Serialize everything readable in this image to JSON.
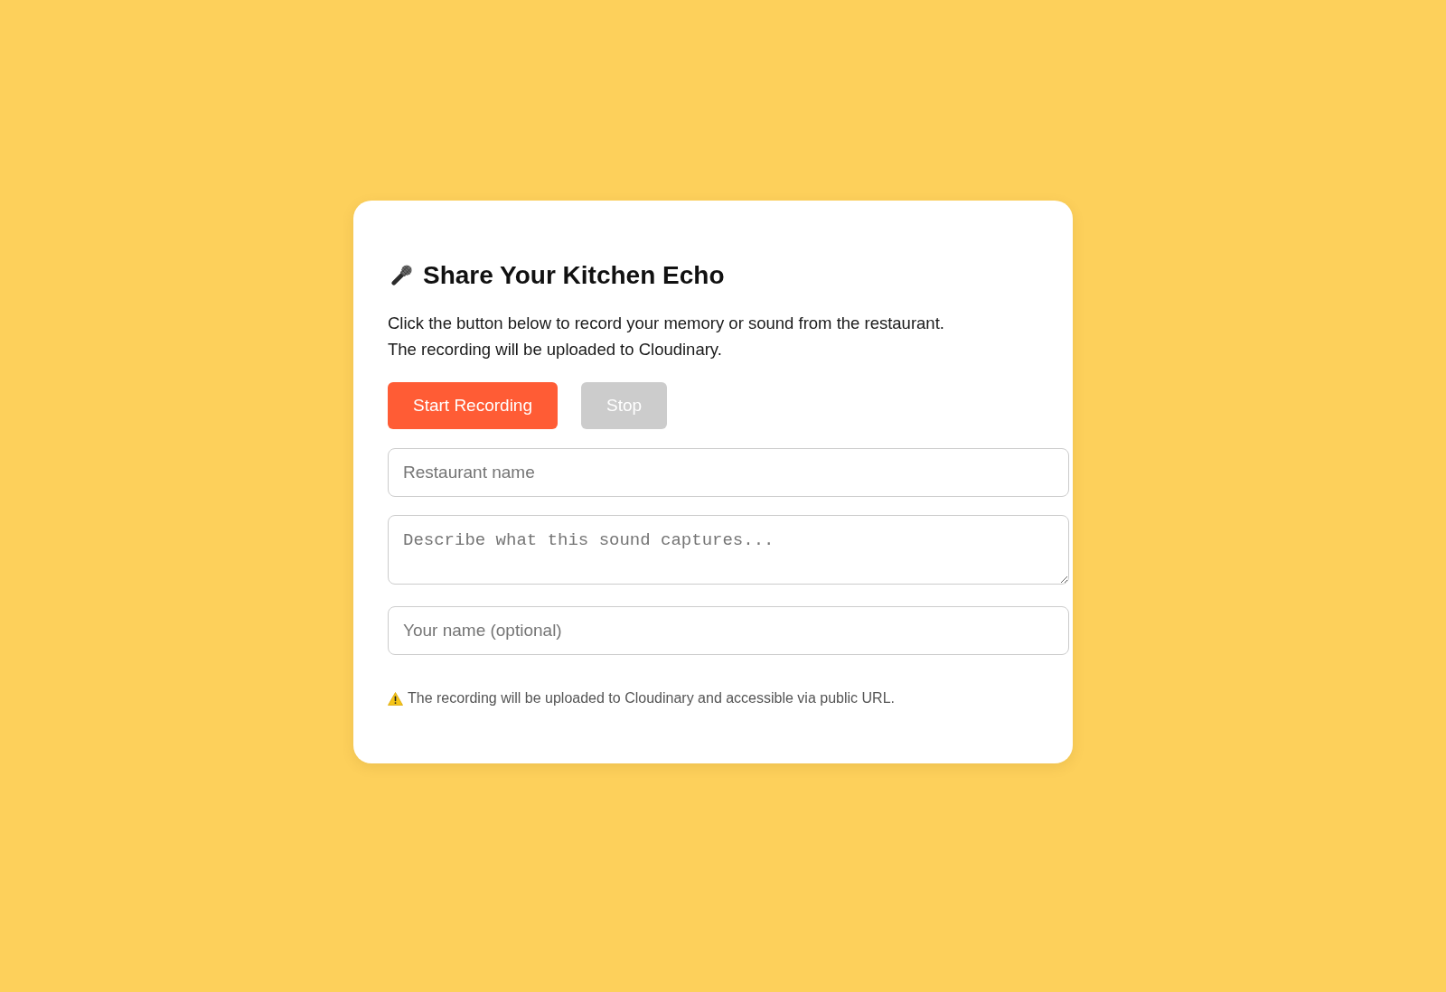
{
  "card": {
    "title": "Share Your Kitchen Echo",
    "description": [
      "Click the button below to record your memory or sound from the restaurant.",
      "The recording will be uploaded to Cloudinary."
    ],
    "buttons": [
      {
        "label": "Start Recording",
        "kind": "primary",
        "disabled": false
      },
      {
        "label": "Stop",
        "kind": "secondary",
        "disabled": true
      }
    ],
    "fields": [
      {
        "kind": "input",
        "placeholder": "Restaurant name"
      },
      {
        "kind": "textarea",
        "placeholder": "Describe what this sound captures..."
      },
      {
        "kind": "input",
        "placeholder": "Your name (optional)"
      }
    ],
    "notice": "The recording will be uploaded to Cloudinary and accessible via public URL."
  }
}
